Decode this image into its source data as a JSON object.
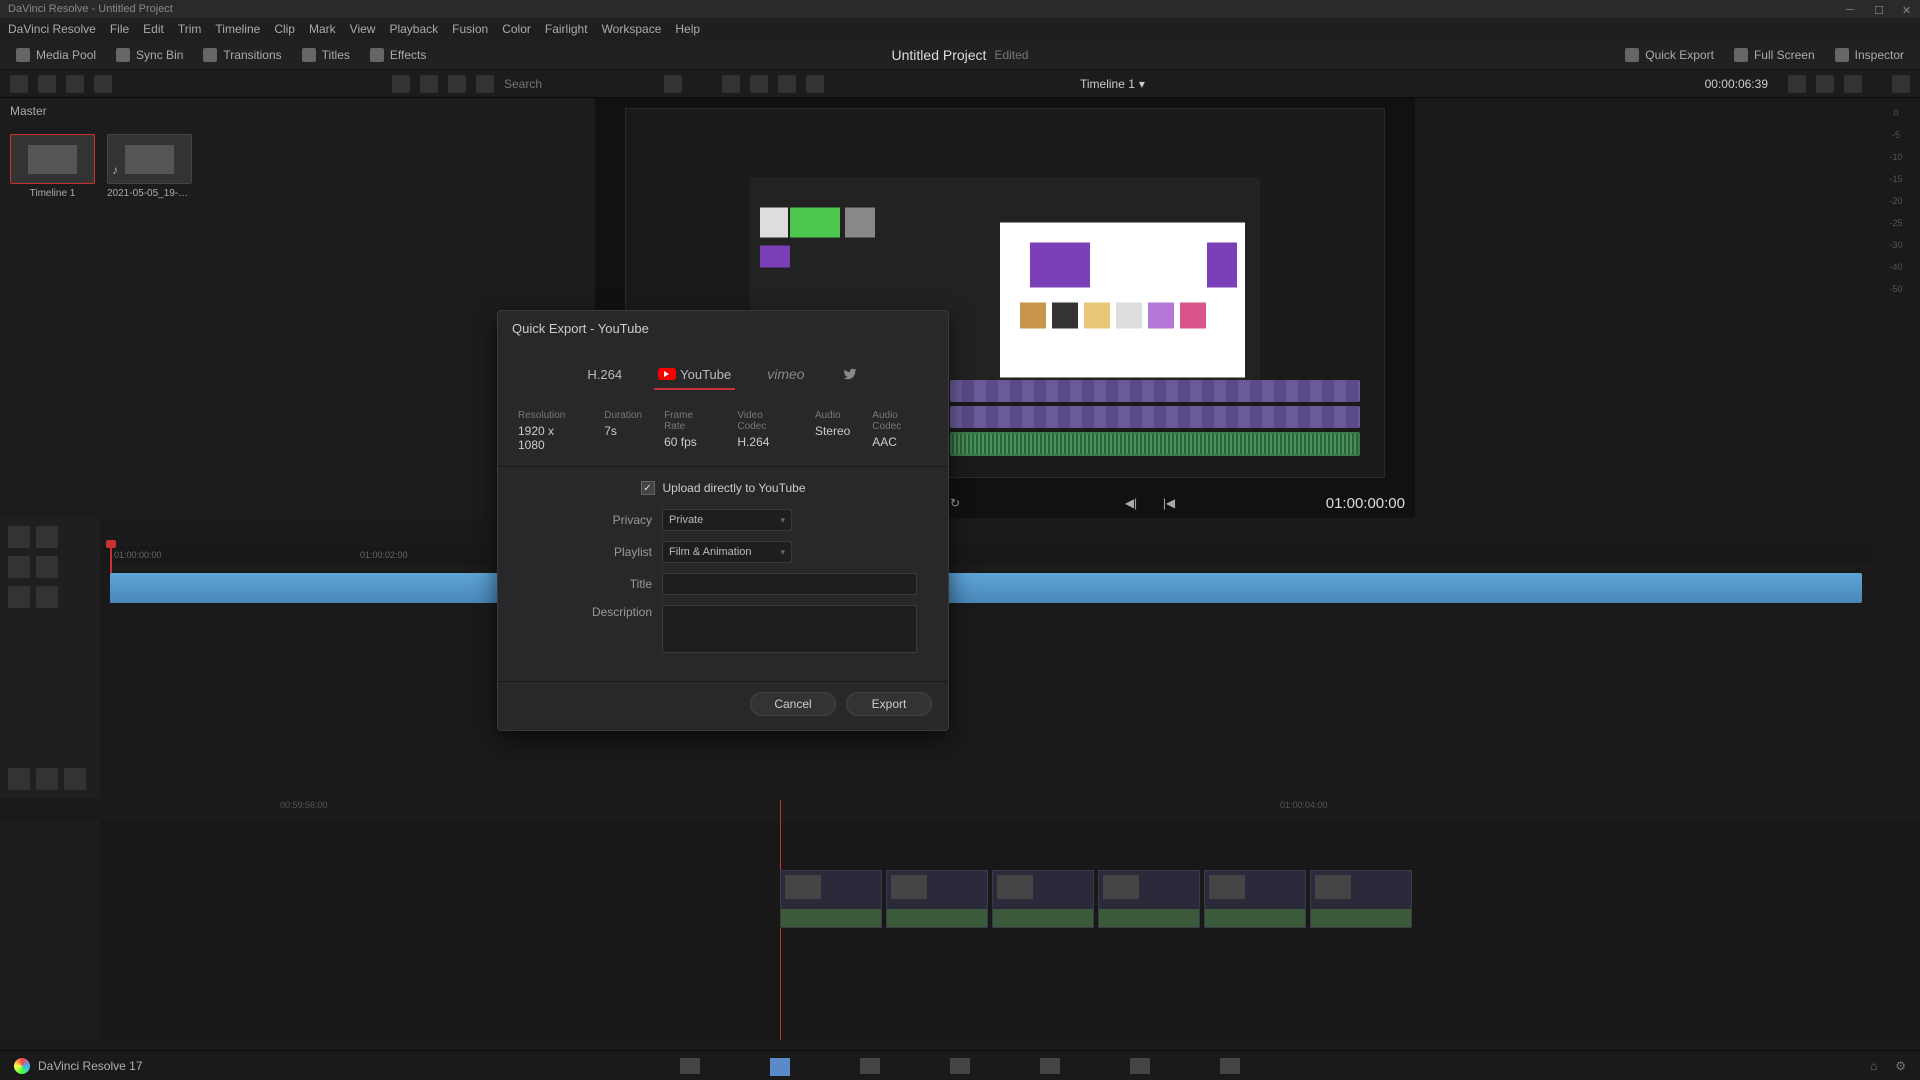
{
  "window": {
    "app_title": "DaVinci Resolve - Untitled Project"
  },
  "menu": {
    "items": [
      "DaVinci Resolve",
      "File",
      "Edit",
      "Trim",
      "Timeline",
      "Clip",
      "Mark",
      "View",
      "Playback",
      "Fusion",
      "Color",
      "Fairlight",
      "Workspace",
      "Help"
    ]
  },
  "toolbar": {
    "media_pool": "Media Pool",
    "sync_bin": "Sync Bin",
    "transitions": "Transitions",
    "titles": "Titles",
    "effects": "Effects",
    "project_title": "Untitled Project",
    "edited": "Edited",
    "quick_export": "Quick Export",
    "full_screen": "Full Screen",
    "inspector": "Inspector"
  },
  "secbar": {
    "search_placeholder": "Search",
    "timeline_name": "Timeline 1",
    "timecode": "00:00:06:39"
  },
  "media": {
    "master": "Master",
    "thumbs": [
      {
        "label": "Timeline 1"
      },
      {
        "label": "2021-05-05_19-14-..."
      }
    ]
  },
  "viewer": {
    "tc": "01:00:00:00"
  },
  "timeline": {
    "ruler_marks": [
      "01:00:00:00",
      "01:00:02:00"
    ],
    "lt_marks": [
      "00:59:56:00",
      "01:00:04:00"
    ]
  },
  "dialog": {
    "title": "Quick Export - YouTube",
    "presets": {
      "h264": "H.264",
      "youtube": "YouTube",
      "vimeo": "vimeo"
    },
    "specs": {
      "resolution_label": "Resolution",
      "resolution_value": "1920 x 1080",
      "duration_label": "Duration",
      "duration_value": "7s",
      "framerate_label": "Frame Rate",
      "framerate_value": "60 fps",
      "vcodec_label": "Video Codec",
      "vcodec_value": "H.264",
      "audio_label": "Audio",
      "audio_value": "Stereo",
      "acodec_label": "Audio Codec",
      "acodec_value": "AAC"
    },
    "form": {
      "upload_label": "Upload directly to YouTube",
      "privacy_label": "Privacy",
      "privacy_value": "Private",
      "playlist_label": "Playlist",
      "playlist_value": "Film & Animation",
      "title_label": "Title",
      "title_value": "",
      "desc_label": "Description",
      "desc_value": ""
    },
    "footer": {
      "cancel": "Cancel",
      "export": "Export"
    }
  },
  "pagebar": {
    "app_name": "DaVinci Resolve 17"
  }
}
